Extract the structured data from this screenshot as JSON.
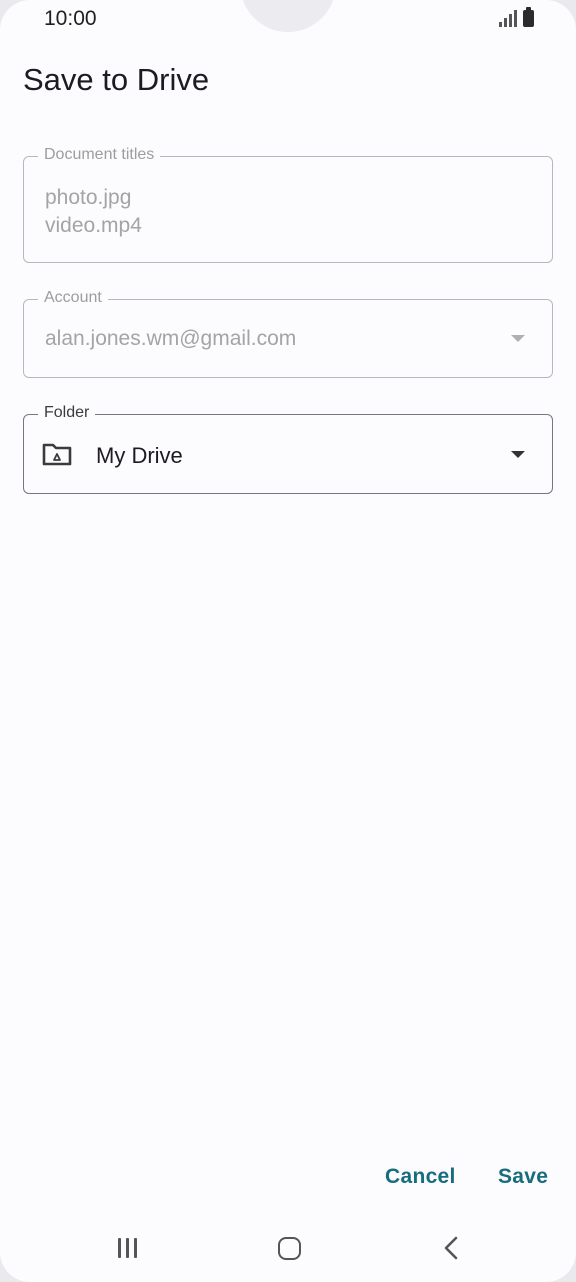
{
  "status_bar": {
    "time": "10:00",
    "icons": [
      "signal-icon",
      "battery-icon"
    ]
  },
  "dialog": {
    "title": "Save to Drive"
  },
  "document_titles": {
    "label": "Document titles",
    "items": [
      "photo.jpg",
      "video.mp4"
    ]
  },
  "account": {
    "label": "Account",
    "value": "alan.jones.wm@gmail.com",
    "icon": "dropdown-caret-icon"
  },
  "folder": {
    "label": "Folder",
    "value": "My Drive",
    "icon": "drive-folder-icon"
  },
  "actions": {
    "cancel_label": "Cancel",
    "save_label": "Save"
  },
  "nav_bar": {
    "icons": [
      "recents-icon",
      "home-icon",
      "back-icon"
    ]
  },
  "colors": {
    "accent": "#176d7d",
    "background": "#fcfbfe",
    "outline": "#79747e",
    "disabled_text": "#a4a4a4"
  }
}
